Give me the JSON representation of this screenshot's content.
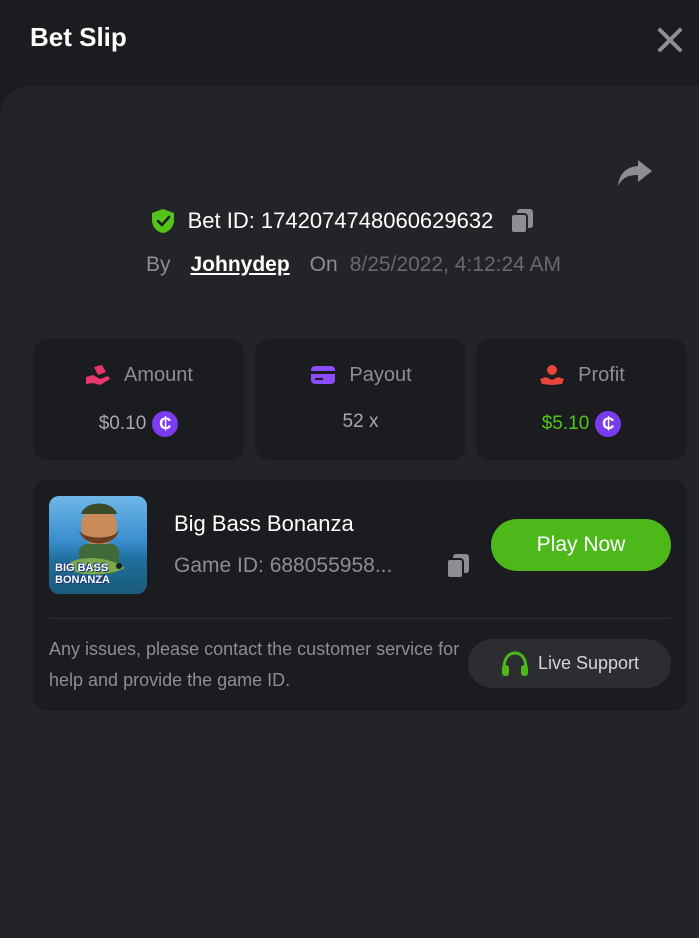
{
  "header": {
    "title": "Bet Slip"
  },
  "bet": {
    "id_label": "Bet ID:",
    "id_value": "1742074748060629632",
    "by_label": "By",
    "username": "Johnydep",
    "on_label": "On",
    "date": "8/25/2022, 4:12:24 AM"
  },
  "stats": {
    "amount": {
      "label": "Amount",
      "value": "$0.10",
      "icon": "hand-coins-icon"
    },
    "payout": {
      "label": "Payout",
      "value": "52 x",
      "icon": "card-icon"
    },
    "profit": {
      "label": "Profit",
      "value": "$5.10",
      "icon": "hand-profit-icon"
    }
  },
  "coin_symbol": "₵",
  "game": {
    "name": "Big Bass Bonanza",
    "id_label": "Game ID:",
    "id_value": "688055958...",
    "thumbnail_title": "BIG BASS BONANZA",
    "play_label": "Play Now"
  },
  "support": {
    "text": "Any issues, please contact the customer service for help and provide the game ID.",
    "button_label": "Live Support"
  },
  "colors": {
    "accent_green": "#4cb81a",
    "profit_green": "#52c41a",
    "coin_purple": "#7b3cf0",
    "amount_pink": "#e8386b",
    "payout_purple": "#8a4dff",
    "profit_red": "#e8443a"
  }
}
